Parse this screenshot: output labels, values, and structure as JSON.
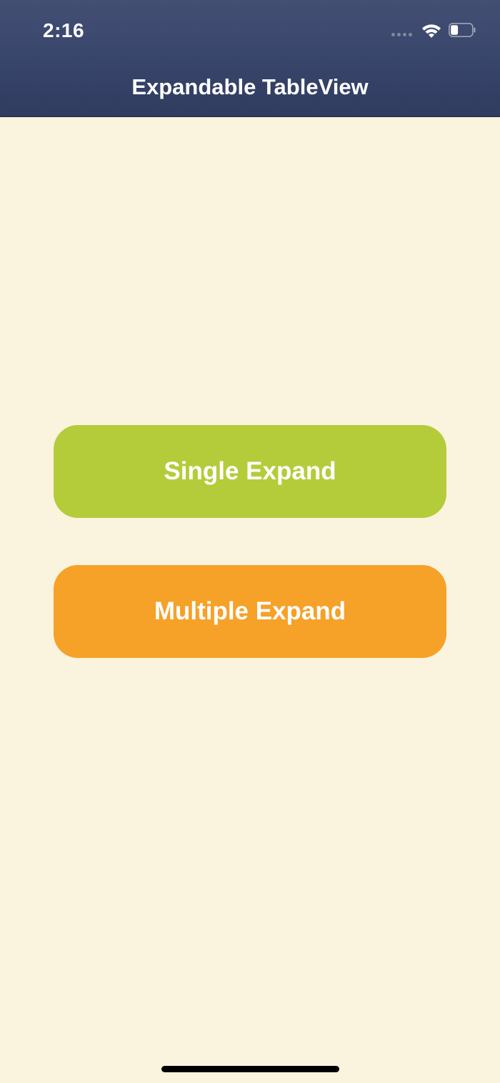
{
  "status_bar": {
    "time": "2:16"
  },
  "nav": {
    "title": "Expandable TableView"
  },
  "buttons": {
    "single_label": "Single Expand",
    "multiple_label": "Multiple Expand"
  },
  "colors": {
    "header": "#39466B",
    "background": "#FAF3DD",
    "single_button": "#B4CC3A",
    "multiple_button": "#F6A128"
  },
  "icons": {
    "signal": "cellular-signal-icon",
    "wifi": "wifi-icon",
    "battery": "battery-icon"
  },
  "battery_level": 0.35
}
